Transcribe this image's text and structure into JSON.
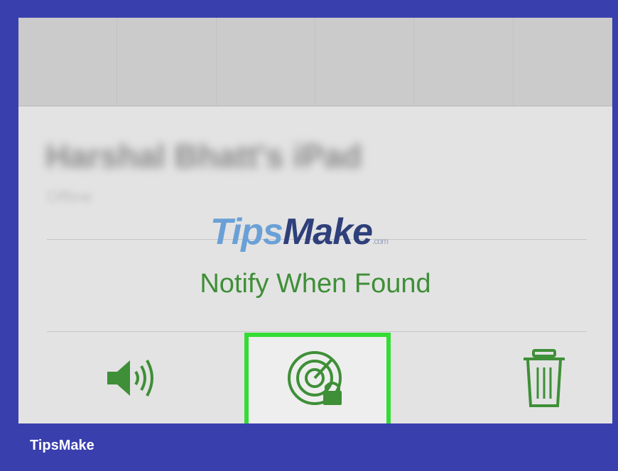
{
  "device": {
    "name": "Harshal Bhatt's iPad",
    "status": "Offline"
  },
  "watermark": {
    "part1": "Tips",
    "part2": "Make",
    "domain": ".com"
  },
  "notify_label": "Notify When Found",
  "actions": {
    "play_sound_icon": "speaker-icon",
    "lost_mode_icon": "radar-lock-icon",
    "erase_icon": "trash-icon"
  },
  "footer": {
    "brand": "TipsMake"
  },
  "colors": {
    "frame_border": "#3a3fae",
    "accent_green": "#3e8f37",
    "highlight_green": "#33dd33"
  }
}
